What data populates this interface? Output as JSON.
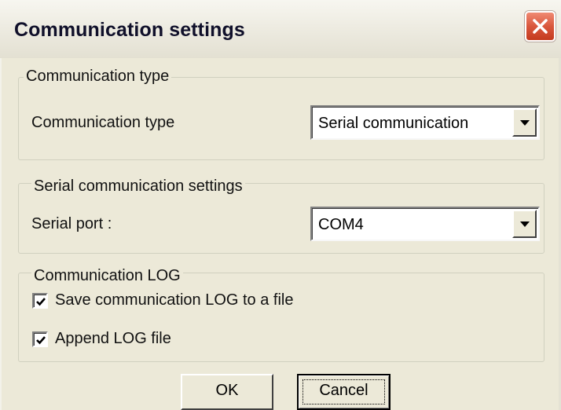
{
  "window": {
    "title": "Communication settings",
    "close_icon": "close-x-icon",
    "close_color": "#d9573d"
  },
  "communication_type_group": {
    "legend": "Communication type",
    "label": "Communication type",
    "selected": "Serial communication"
  },
  "serial_group": {
    "legend": "Serial communication settings",
    "port_label": "Serial port :",
    "port_selected": "COM4"
  },
  "log_group": {
    "legend": "Communication LOG",
    "save_log_label": "Save communication LOG to a file",
    "save_log_checked": true,
    "append_log_label": "Append LOG file",
    "append_log_checked": true
  },
  "buttons": {
    "ok_label": "OK",
    "cancel_label": "Cancel"
  }
}
